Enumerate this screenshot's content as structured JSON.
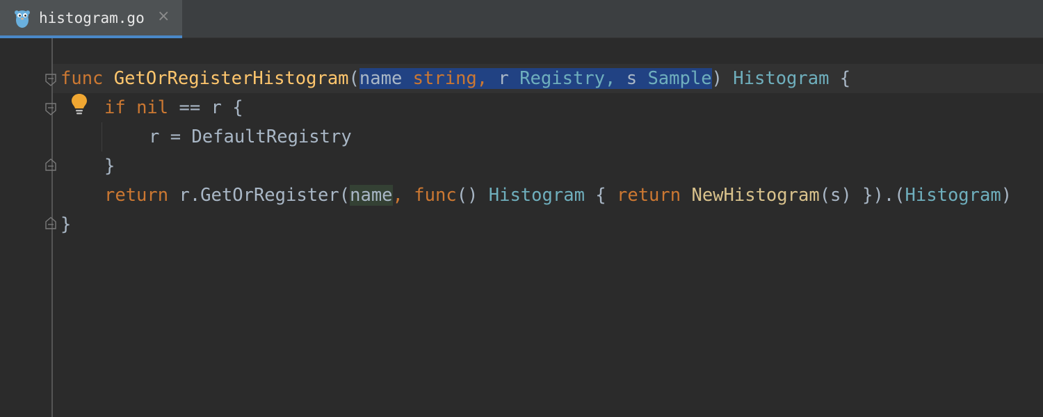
{
  "tab": {
    "filename": "histogram.go",
    "close_symbol": "×",
    "icon": "gopher-icon"
  },
  "code": {
    "line1": {
      "func_kw": "func",
      "fn_name": "GetOrRegisterHistogram",
      "paren_open": "(",
      "p_name": "name ",
      "p_string": "string,",
      "p_r": " r ",
      "p_registry": "Registry,",
      "p_s": " s ",
      "p_sample": "Sample",
      "paren_close": ")",
      "ret_type": "Histogram",
      "brace": " {"
    },
    "line2": {
      "if_kw": "if",
      "nil_kw": "nil",
      "rest": " == r {"
    },
    "line3": {
      "text": "r = DefaultRegistry"
    },
    "line4": {
      "text": "}"
    },
    "line5": {
      "return_kw": "return",
      "call": " r.GetOrRegister(",
      "name": "name",
      "comma": ",",
      "func_kw": "func",
      "parens": "() ",
      "type1": "Histogram",
      "brace": " { ",
      "return_kw2": "return",
      "new_fn": "NewHistogram",
      "args": "(s) }).(",
      "type2": "Histogram",
      "close": ")"
    },
    "line6": {
      "text": "}"
    }
  },
  "colors": {
    "keyword": "#cc7832",
    "function": "#ffc66d",
    "type": "#6fafbd",
    "plain": "#a9b7c6",
    "selection": "#214283",
    "usage_highlight": "#344134",
    "tab_underline": "#4a88c7"
  }
}
